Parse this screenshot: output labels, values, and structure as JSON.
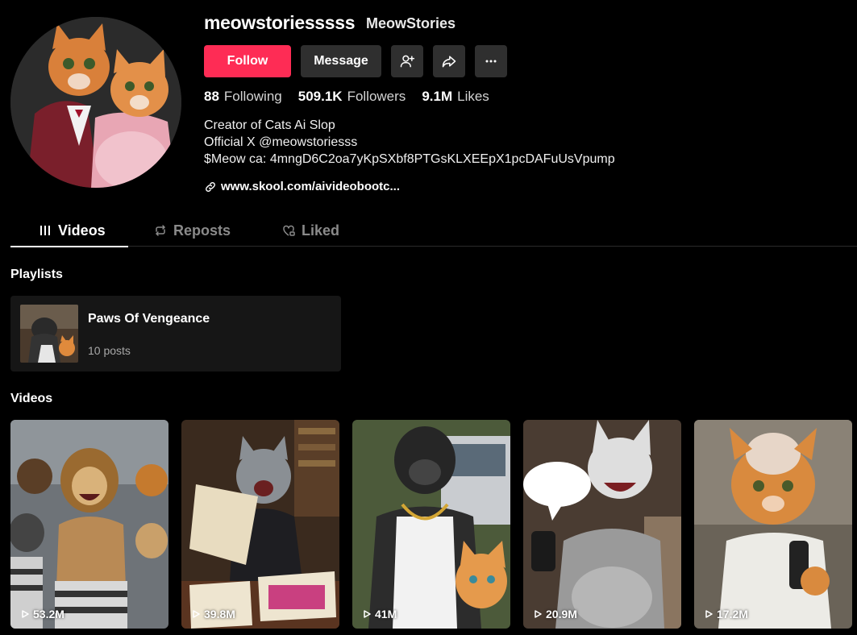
{
  "profile": {
    "username": "meowstoriesssss",
    "nickname": "MeowStories",
    "follow_label": "Follow",
    "message_label": "Message",
    "stats": [
      {
        "value": "88",
        "label": "Following"
      },
      {
        "value": "509.1K",
        "label": "Followers"
      },
      {
        "value": "9.1M",
        "label": "Likes"
      }
    ],
    "bio_lines": [
      "Creator of Cats Ai Slop",
      "Official X @meowstoriesss",
      "$Meow ca: 4mngD6C2oa7yKpSXbf8PTGsKLXEEpX1pcDAFuUsVpump"
    ],
    "link": "www.skool.com/aivideobootc..."
  },
  "tabs": [
    {
      "label": "Videos",
      "active": true
    },
    {
      "label": "Reposts",
      "active": false
    },
    {
      "label": "Liked",
      "active": false
    }
  ],
  "playlists": {
    "title": "Playlists",
    "items": [
      {
        "name": "Paws Of Vengeance",
        "count": "10 posts"
      }
    ]
  },
  "videos": {
    "title": "Videos",
    "items": [
      {
        "views": "53.2M"
      },
      {
        "views": "39.8M"
      },
      {
        "views": "41M"
      },
      {
        "views": "20.9M"
      },
      {
        "views": "17.2M"
      }
    ]
  },
  "colors": {
    "accent": "#fe2c55",
    "button_bg": "#2f2f2f",
    "background": "#000000"
  }
}
